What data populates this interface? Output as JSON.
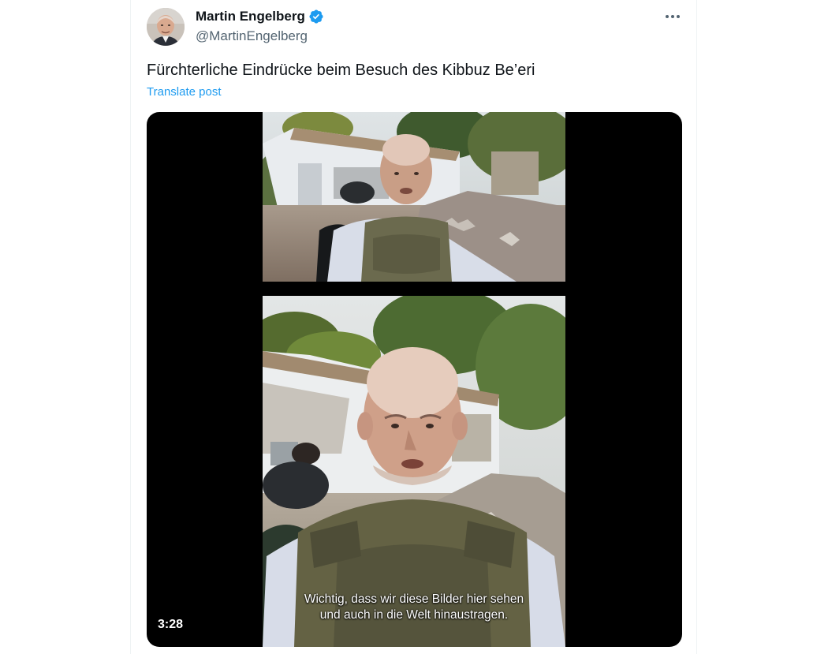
{
  "tweet": {
    "author": {
      "display_name": "Martin Engelberg",
      "handle": "@MartinEngelberg",
      "verified": true,
      "avatar_icon": "person-avatar"
    },
    "more_icon": "more-dots-icon",
    "text": "Fürchterliche Eindrücke beim Besuch des Kibbuz Be’eri",
    "translate_label": "Translate post",
    "media": {
      "duration": "3:28",
      "subtitle_line1": "Wichtig, dass wir diese Bilder hier sehen",
      "subtitle_line2": "und auch in die Welt hinaustragen."
    }
  },
  "colors": {
    "text_primary": "#0f1419",
    "text_secondary": "#536471",
    "link": "#1d9bf0",
    "verified_badge": "#1d9bf0",
    "media_background": "#000000"
  }
}
